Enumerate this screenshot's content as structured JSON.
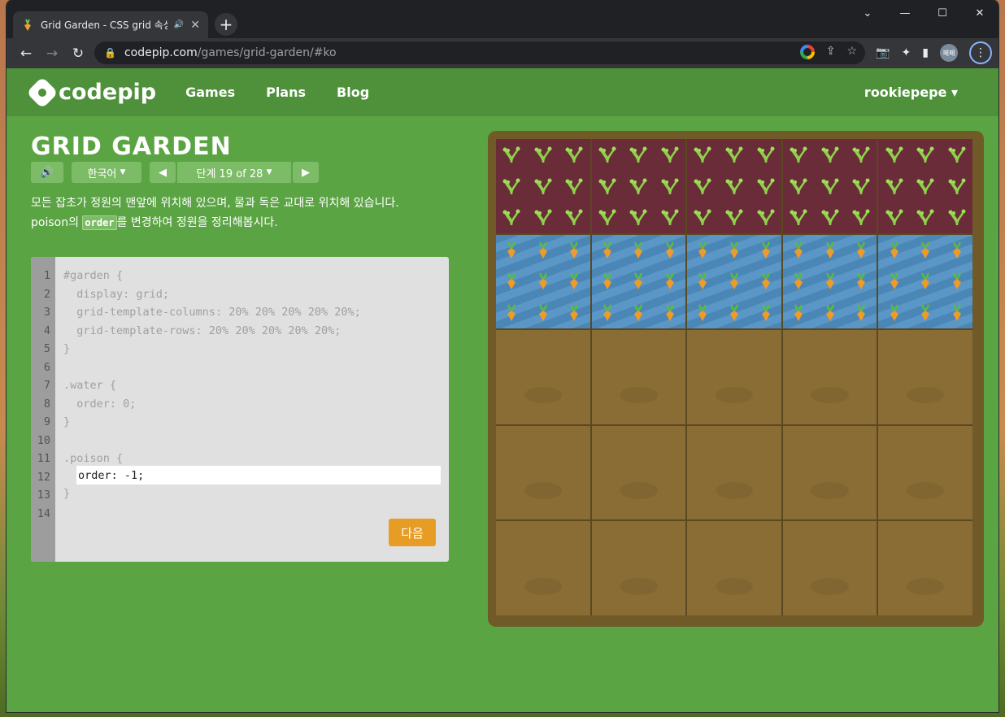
{
  "browser": {
    "tab_title": "Grid Garden - CSS grid 속성",
    "url_host": "codepip.com",
    "url_path": "/games/grid-garden/#ko",
    "profile_label": "페페"
  },
  "site": {
    "logo": "codepip",
    "nav": [
      "Games",
      "Plans",
      "Blog"
    ],
    "user": "rookiepepe"
  },
  "game": {
    "title": "GRID GARDEN",
    "language": "한국어",
    "level": "단계 19 of 28",
    "instruction_line1": "모든 잡초가 정원의 맨앞에 위치해 있으며, 물과 독은 교대로 위치해 있습니다.",
    "instruction_pre": "poison의 ",
    "instruction_code": "order",
    "instruction_post": "를 변경하여 정원을 정리해봅시다.",
    "next_label": "다음"
  },
  "editor": {
    "line_numbers": "1\n2\n3\n4\n5\n6\n7\n8\n9\n10\n11\n12\n13\n14",
    "code_before": "#garden {\n  display: grid;\n  grid-template-columns: 20% 20% 20% 20% 20%;\n  grid-template-rows: 20% 20% 20% 20% 20%;\n}\n\n.water {\n  order: 0;\n}\n\n.poison {",
    "input_value": "order: -1;",
    "code_after": "}"
  },
  "garden_rows": [
    "poison",
    "water",
    "dirt",
    "dirt",
    "dirt"
  ],
  "colors": {
    "site_green": "#5ba444",
    "header_green": "#4e913a",
    "next_button": "#e79d25",
    "poison": "#6b2c3a",
    "water": "#4b87b6",
    "dirt": "#8a6c35"
  }
}
